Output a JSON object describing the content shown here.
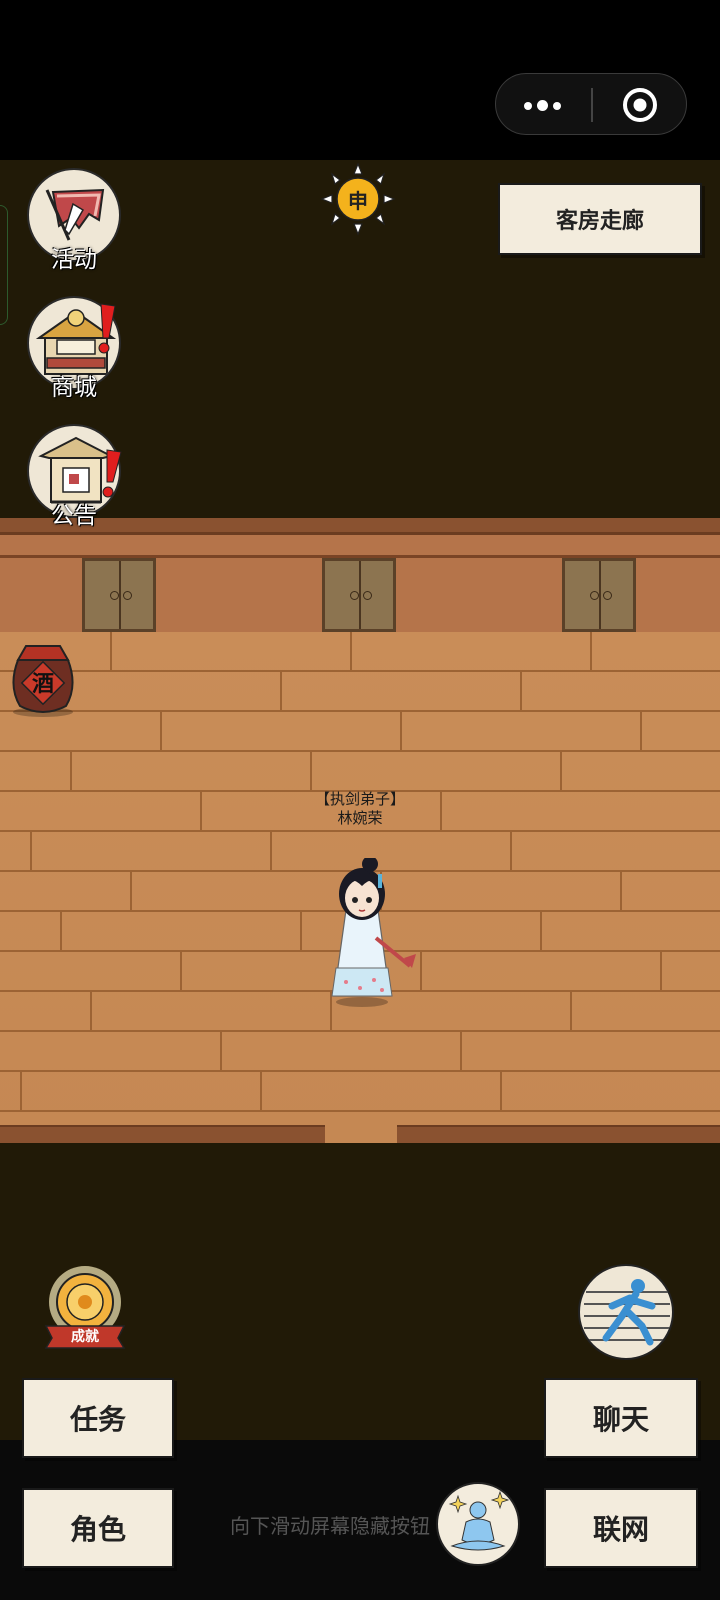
{
  "location_label": "客房走廊",
  "time_label": "申",
  "left_menu": [
    {
      "label": "活动",
      "icon": "banner-sword-icon",
      "alert": false
    },
    {
      "label": "商城",
      "icon": "shop-stall-icon",
      "alert": true
    },
    {
      "label": "公告",
      "icon": "notice-pavilion-icon",
      "alert": true
    }
  ],
  "wine_jar_label": "酒",
  "character": {
    "title": "【执剑弟子】",
    "name": "林婉荣"
  },
  "achievement_label": "成就",
  "buttons": {
    "quest": "任务",
    "role": "角色",
    "chat": "聊天",
    "online": "联网"
  },
  "hint_text": "向下滑动屏幕隐藏按钮"
}
